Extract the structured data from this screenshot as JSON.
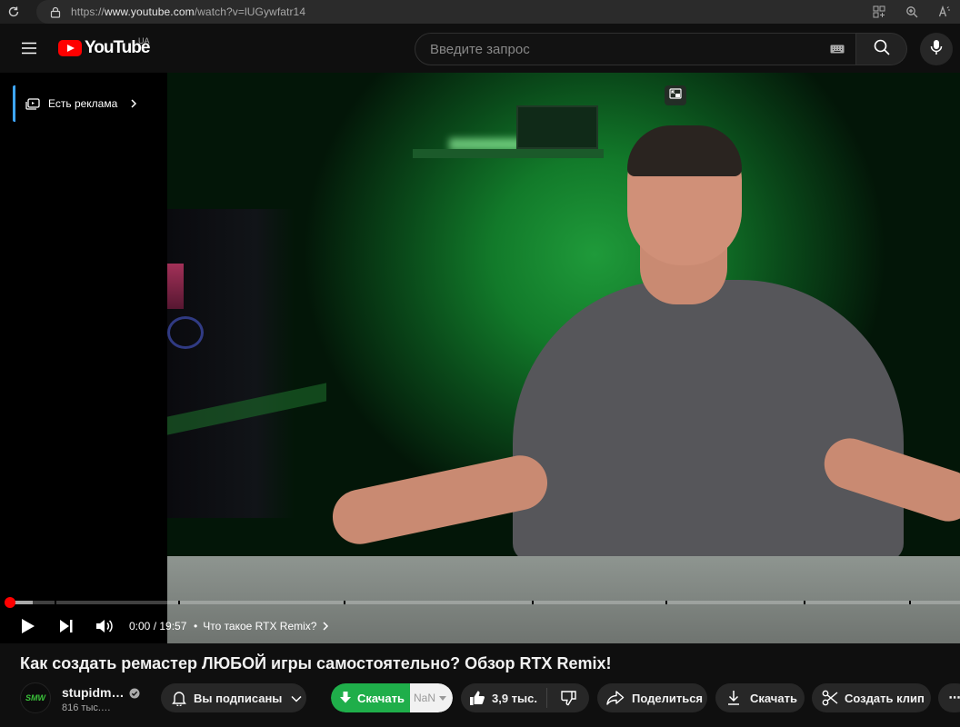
{
  "browser": {
    "url_prefix": "https://",
    "url_host": "www.youtube.com",
    "url_path": "/watch?v=lUGywfatr14"
  },
  "masthead": {
    "logo_text": "YouTube",
    "country": "UA",
    "search_placeholder": "Введите запрос"
  },
  "player": {
    "ad_label": "Есть реклама",
    "time": "0:00 / 19:57",
    "chapter_dot": "•",
    "chapter": "Что такое RTX Remix?",
    "progress_fraction": 0
  },
  "video": {
    "title": "Как создать ремастер ЛЮБОЙ игры самостоятельно? Обзор RTX Remix!",
    "channel_avatar_text": "SMW",
    "channel_name": "stupidm…",
    "subscribers": "816 тыс.…"
  },
  "actions": {
    "subscribe_label": "Вы подписаны",
    "download_label": "Скачать",
    "download_side": "NaN",
    "likes": "3,9 тыс.",
    "share_label": "Поделиться",
    "save_label": "Скачать",
    "clip_label": "Создать клип",
    "more_label": "⋯"
  },
  "colors": {
    "accent_red": "#ff0000",
    "download_green": "#1fae4a",
    "ad_accent": "#3ea6ff"
  }
}
